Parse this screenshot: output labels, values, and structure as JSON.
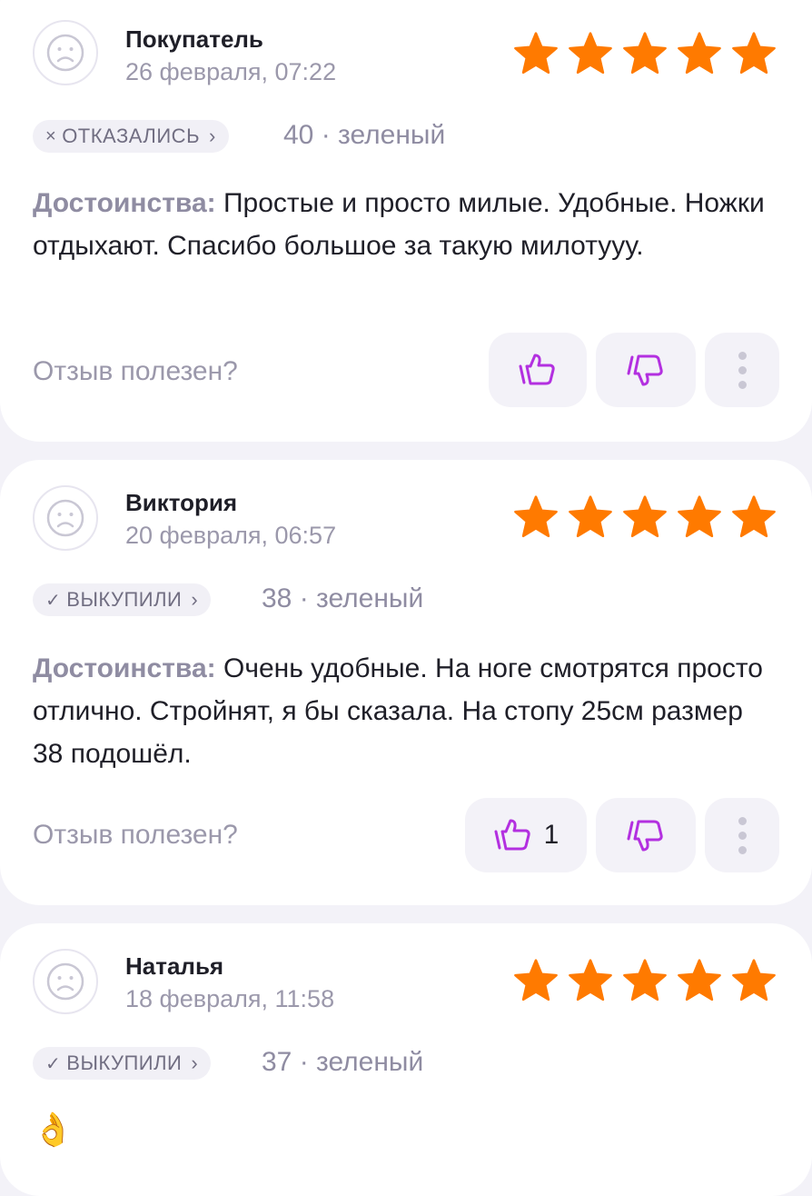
{
  "reviews": [
    {
      "author": "Покупатель",
      "date": "26 февраля, 07:22",
      "rating": 5,
      "status_mark": "×",
      "status": "ОТКАЗАЛИСЬ",
      "status_chevron": "›",
      "size_color": "40 · зеленый",
      "pros_label": "Достоинства:",
      "pros_text": "Простые и просто милые.  Удобные. Ножки отдыхают. Спасибо большое за такую милотууу.",
      "helpful_prompt": "Отзыв полезен?",
      "like_count": ""
    },
    {
      "author": "Виктория",
      "date": "20 февраля, 06:57",
      "rating": 5,
      "status_mark": "✓",
      "status": "ВЫКУПИЛИ",
      "status_chevron": "›",
      "size_color": "38 · зеленый",
      "pros_label": "Достоинства:",
      "pros_text": "Очень удобные. На ноге смотрятся просто отлично. Стройнят, я бы сказала.   На стопу 25см размер 38 подошёл.",
      "helpful_prompt": "Отзыв полезен?",
      "like_count": "1"
    },
    {
      "author": "Наталья",
      "date": "18 февраля, 11:58",
      "rating": 5,
      "status_mark": "✓",
      "status": "ВЫКУПИЛИ",
      "status_chevron": "›",
      "size_color": "37 · зеленый",
      "comment": "👌"
    }
  ],
  "icons": {
    "avatar": "sad-face-icon",
    "star": "star-icon",
    "like": "thumbs-up-icon",
    "dislike": "thumbs-down-icon",
    "more": "more-vertical-icon"
  },
  "colors": {
    "star": "#ff7a00",
    "accent": "#b330e0",
    "label": "#8f8ca2"
  }
}
